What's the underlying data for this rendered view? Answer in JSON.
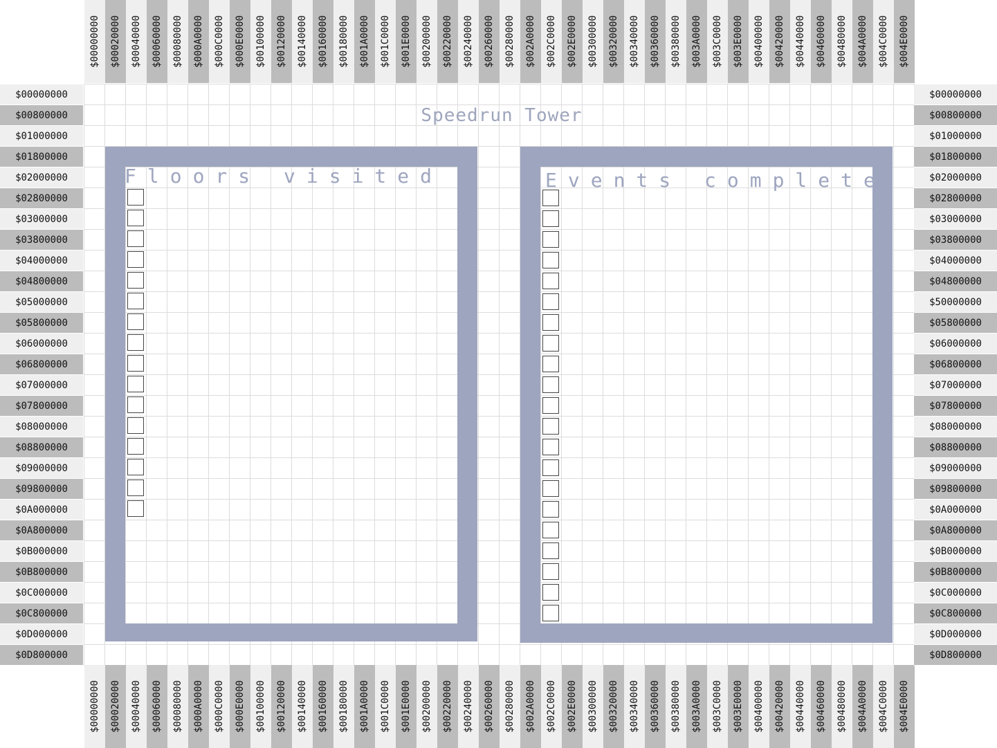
{
  "title": "Speedrun Tower",
  "column_labels": [
    "$00000000",
    "$00020000",
    "$00040000",
    "$00060000",
    "$00080000",
    "$000A0000",
    "$000C0000",
    "$000E0000",
    "$00100000",
    "$00120000",
    "$00140000",
    "$00160000",
    "$00180000",
    "$001A0000",
    "$001C0000",
    "$001E0000",
    "$00200000",
    "$00220000",
    "$00240000",
    "$00260000",
    "$00280000",
    "$002A0000",
    "$002C0000",
    "$002E0000",
    "$00300000",
    "$00320000",
    "$00340000",
    "$00360000",
    "$00380000",
    "$003A0000",
    "$003C0000",
    "$003E0000",
    "$00400000",
    "$00420000",
    "$00440000",
    "$00460000",
    "$00480000",
    "$004A0000",
    "$004C0000",
    "$004E0000"
  ],
  "row_labels_left": [
    "$00000000",
    "$00800000",
    "$01000000",
    "$01800000",
    "$02000000",
    "$02800000",
    "$03000000",
    "$03800000",
    "$04000000",
    "$04800000",
    "$05000000",
    "$05800000",
    "$06000000",
    "$06800000",
    "$07000000",
    "$07800000",
    "$08000000",
    "$08800000",
    "$09000000",
    "$09800000",
    "$0A000000",
    "$0A800000",
    "$0B000000",
    "$0B800000",
    "$0C000000",
    "$0C800000",
    "$0D000000",
    "$0D800000"
  ],
  "row_labels_right": [
    "$00000000",
    "$00800000",
    "$01000000",
    "$01800000",
    "$02000000",
    "$02800000",
    "$03000000",
    "$03800000",
    "$04000000",
    "$04800000",
    "$50000000",
    "$05800000",
    "$06000000",
    "$06800000",
    "$07000000",
    "$07800000",
    "$08000000",
    "$08800000",
    "$09000000",
    "$09800000",
    "$0A000000",
    "$0A800000",
    "$0B000000",
    "$0B800000",
    "$0C000000",
    "$0C800000",
    "$0D000000",
    "$0D800000"
  ],
  "panels": {
    "floors": {
      "heading": "Floors visited",
      "checkbox_count": 16,
      "checked": []
    },
    "events": {
      "heading": "Events complete",
      "checkbox_count": 21,
      "checked": []
    }
  },
  "colors": {
    "panel_frame": "#9ea5bf",
    "ruler_light": "#efefef",
    "ruler_dark": "#bcbcbc",
    "grid_line": "#dcdcdc"
  }
}
